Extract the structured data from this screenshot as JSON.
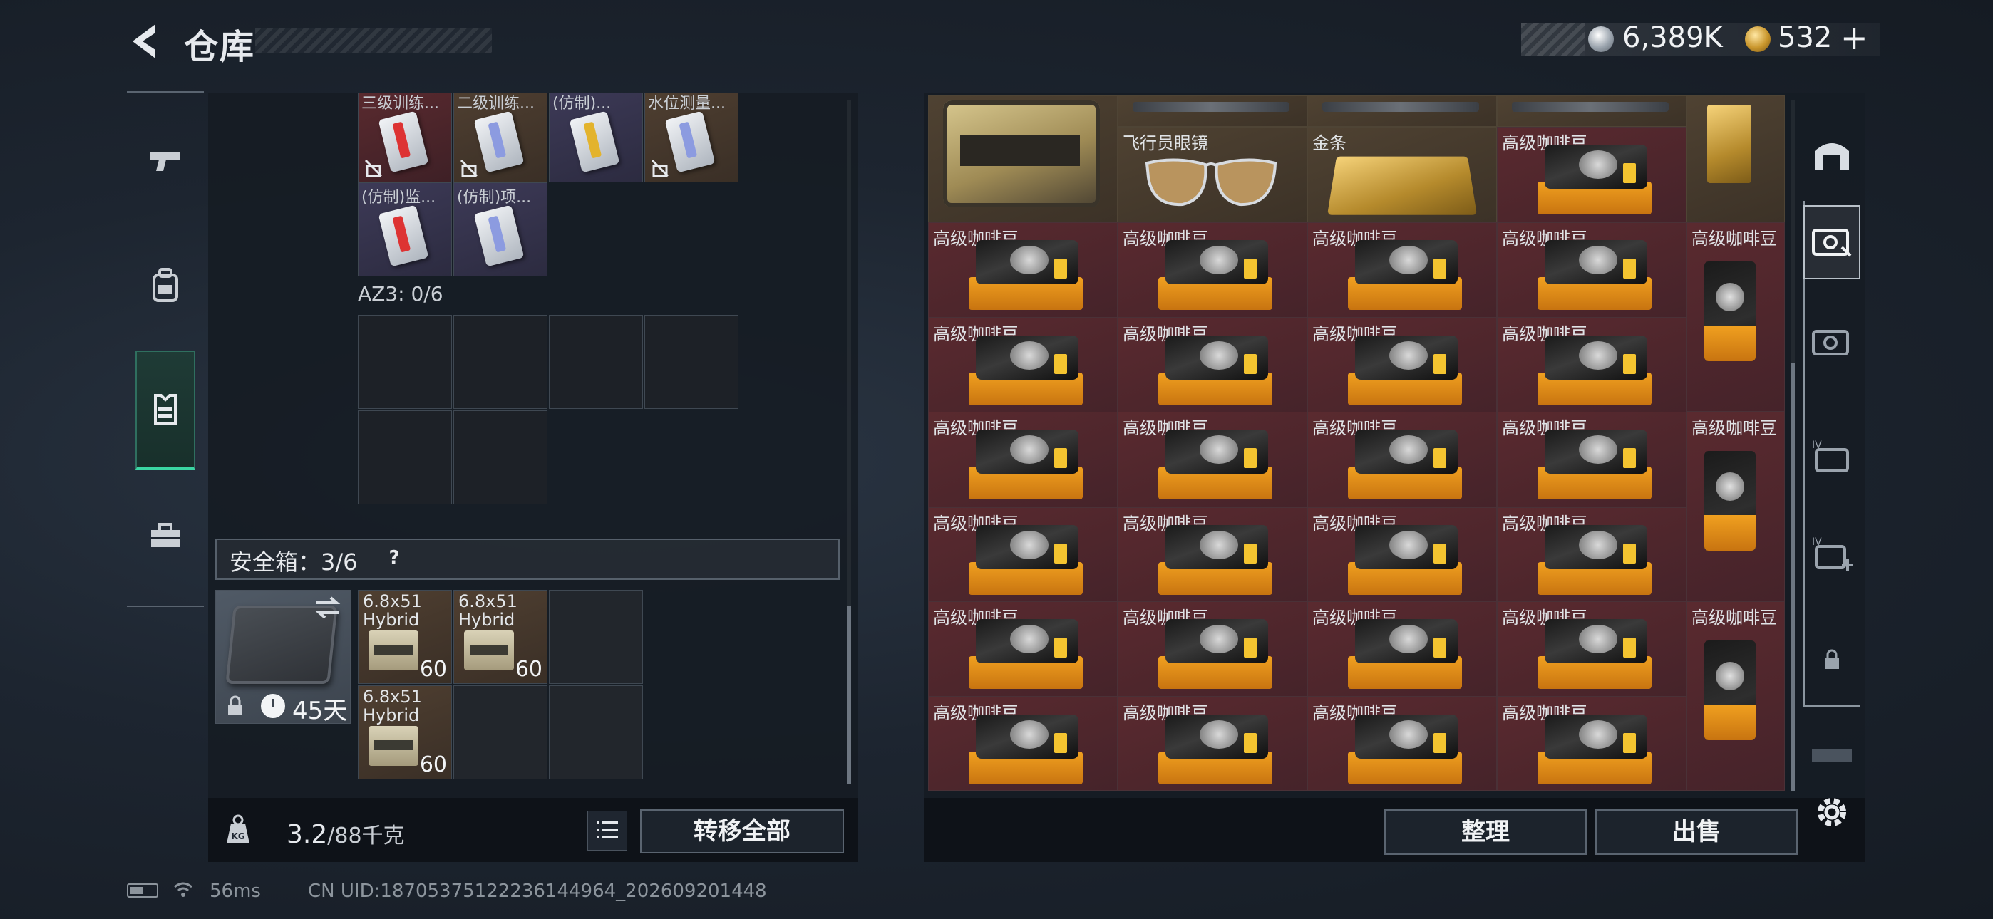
{
  "header": {
    "title": "仓库",
    "silver": "6,389K",
    "gold": "532",
    "gold_plus": "+"
  },
  "left": {
    "row1_items": [
      {
        "label": "三级训练...",
        "style": "red",
        "card": "red",
        "locked": true
      },
      {
        "label": "二级训练...",
        "style": "brown",
        "card": "blue",
        "locked": true
      },
      {
        "label": "(仿制)...",
        "style": "purple",
        "card": "yellow",
        "locked": false
      },
      {
        "label": "水位测量...",
        "style": "brown",
        "card": "blue",
        "locked": true
      }
    ],
    "row2_items": [
      {
        "label": "(仿制)监...",
        "style": "purple",
        "card": "red"
      },
      {
        "label": "(仿制)项...",
        "style": "purple",
        "card": "blue"
      }
    ],
    "az3_label": "AZ3: 0/6",
    "safe_label": "安全箱：3/6",
    "help": "?",
    "case_days": "45天",
    "ammo": [
      {
        "name": "6.8x51\nHybrid",
        "count": "60"
      },
      {
        "name": "6.8x51\nHybrid",
        "count": "60"
      },
      {
        "name": "6.8x51\nHybrid",
        "count": "60"
      }
    ],
    "weight_value": "3.2",
    "weight_max": "/88千克",
    "transfer_all": "转移全部"
  },
  "right": {
    "aviator_label": "飞行员眼镜",
    "goldbar_label": "金条",
    "coffee_label": "高级咖啡豆",
    "sort": "整理",
    "sell": "出售"
  },
  "status": {
    "ping": "56ms",
    "uid": "CN UID:187053751222361449​64_202609201448"
  },
  "icons": {
    "nav": [
      "pistol-icon",
      "backpack-icon",
      "vest-icon",
      "toolbox-icon"
    ],
    "rail": [
      "building-icon",
      "safe-case-icon",
      "case-v-icon",
      "case-iv-icon",
      "case-iv-plus-icon",
      "lock-icon",
      "ticket-icon",
      "gear-icon"
    ]
  }
}
